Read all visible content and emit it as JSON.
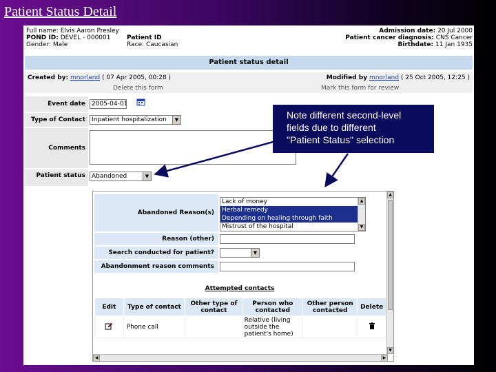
{
  "slide": {
    "title": "Patient Status Detail",
    "callout_lines": [
      "Note different second-level",
      "fields due to different",
      "\"Patient Status\" selection"
    ]
  },
  "header": {
    "full_name_label": "Full name:",
    "full_name": "Elvis Aaron Presley",
    "pond_id_label": "POND ID:",
    "pond_id": "DEVEL - 000001",
    "gender_label": "Gender:",
    "gender": "Male",
    "patient_id_label": "Patient ID",
    "race_label": "Race:",
    "race": "Caucasian",
    "admission_label": "Admission date:",
    "admission_date": "20 Jul 2000",
    "diagnosis_label": "Patient cancer diagnosis:",
    "diagnosis": "CNS Cancer",
    "birthdate_label": "Birthdate:",
    "birthdate": "11 Jan 1935"
  },
  "form_title": "Patient status detail",
  "meta": {
    "created_by_label": "Created by:",
    "created_by_user": "mnorland",
    "created_on": "( 07 Apr 2005, 00:28 )",
    "modified_by_label": "Modified by",
    "modified_by_user": "mnorland",
    "modified_on": "( 25 Oct 2005, 12:25 )",
    "delete_label": "Delete this form",
    "review_label": "Mark this form for review"
  },
  "fields": {
    "event_date_label": "Event date",
    "event_date": "2005-04-01",
    "type_of_contact_label": "Type of Contact",
    "type_of_contact": "Inpatient hospitalization",
    "comments_label": "Comments",
    "patient_status_label": "Patient status",
    "patient_status": "Abandoned"
  },
  "detail": {
    "abandoned_reasons_label": "Abandoned Reason(s)",
    "reason_options": [
      {
        "label": "Lack of money",
        "selected": false
      },
      {
        "label": "Herbal remedy",
        "selected": true
      },
      {
        "label": "Depending on healing through faith",
        "selected": true
      },
      {
        "label": "Mistrust of the hospital",
        "selected": false
      }
    ],
    "reason_other_label": "Reason (other)",
    "search_label": "Search conducted for patient?",
    "abandonment_comments_label": "Abandonment reason comments",
    "attempted_contacts_title": "Attempted contacts",
    "table_headers": [
      "Edit",
      "Type of contact",
      "Other type of contact",
      "Person who contacted",
      "Other person contacted",
      "Delete"
    ],
    "rows": [
      {
        "type": "Phone call",
        "other_type": "",
        "person": "Relative (living outside the patient's home)",
        "other_person": ""
      }
    ]
  }
}
